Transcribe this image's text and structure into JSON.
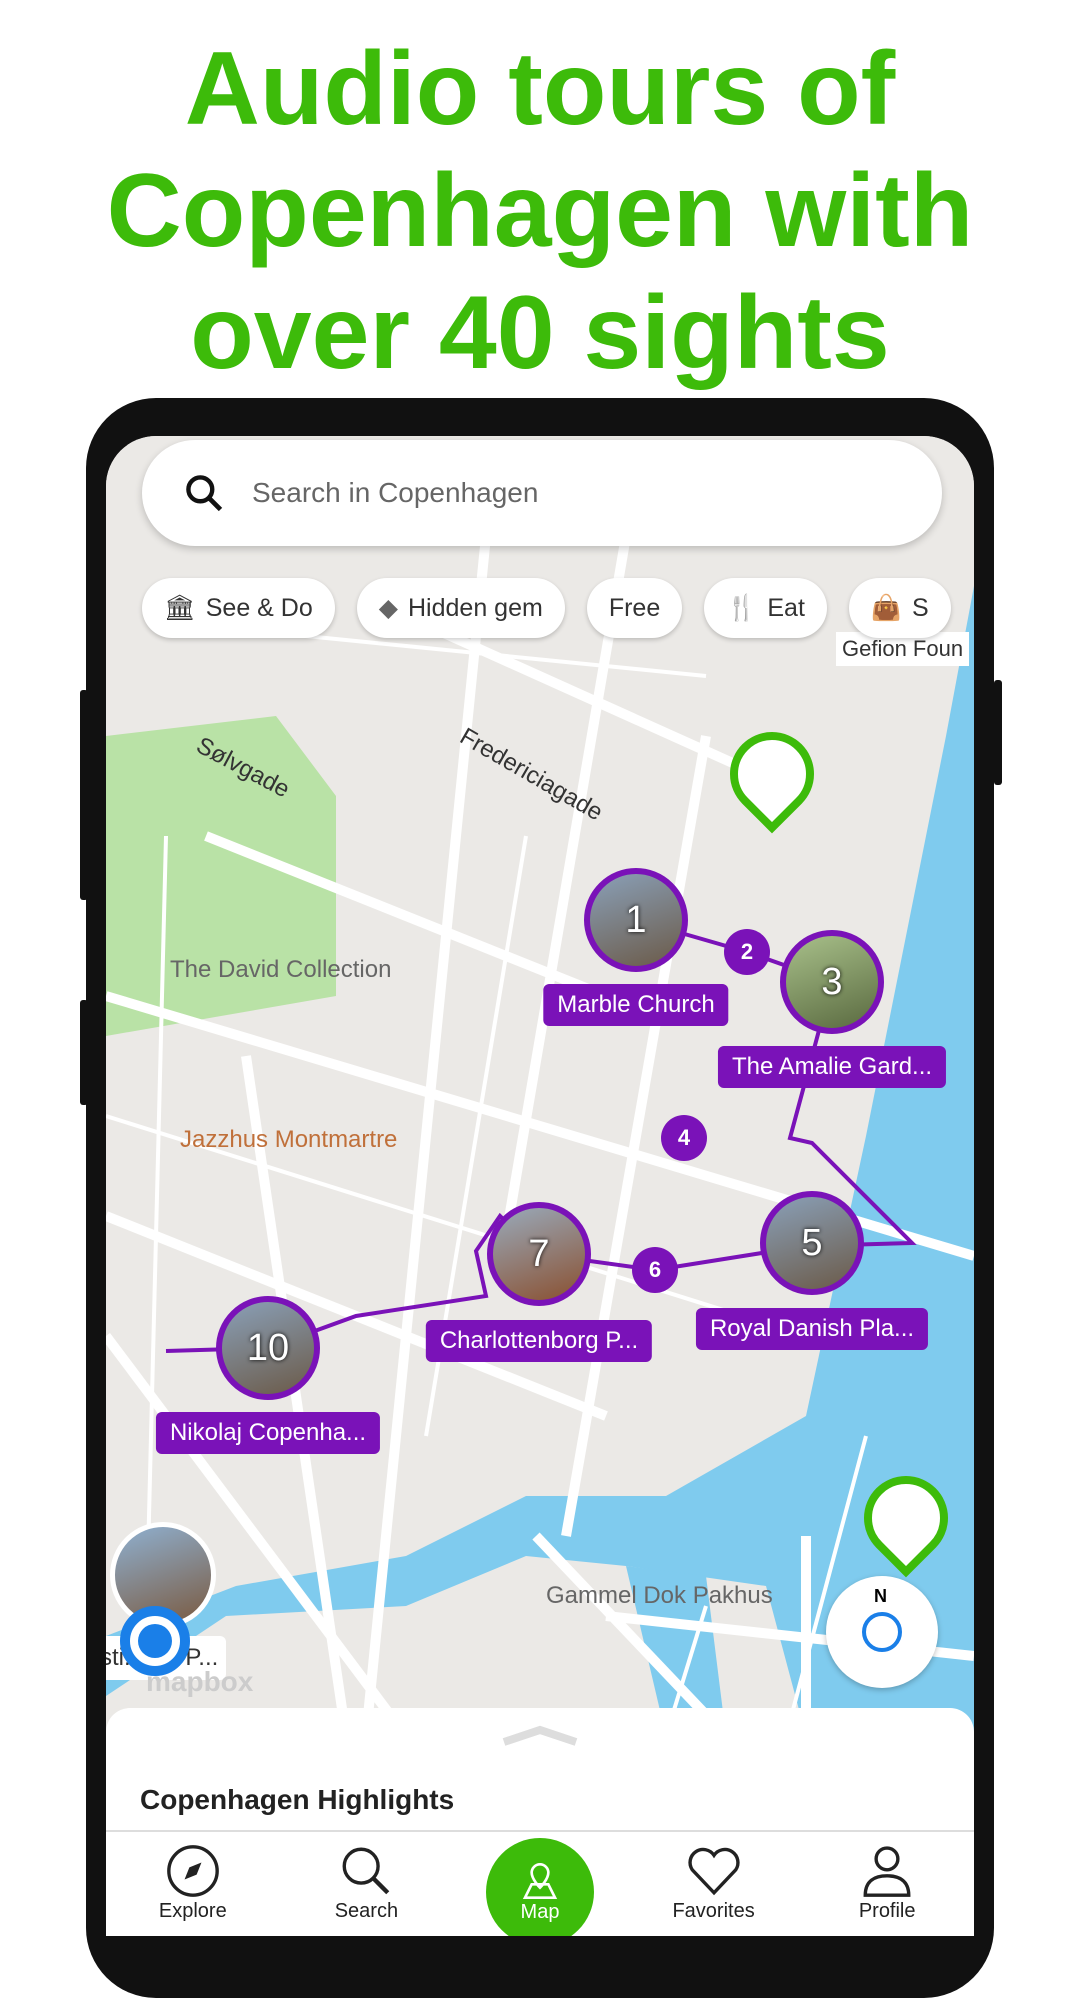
{
  "headline": [
    "Audio tours of",
    "Copenhagen with",
    "over 40 sights"
  ],
  "colors": {
    "brand_green": "#3dbb0a",
    "route_purple": "#7a12b8",
    "water": "#7fcbee",
    "park": "#b9e2a6"
  },
  "search": {
    "placeholder": "Search in Copenhagen",
    "icon": "search-icon"
  },
  "chips": [
    {
      "label": "See & Do",
      "icon": "museum-icon"
    },
    {
      "label": "Hidden gem",
      "icon": "diamond-icon"
    },
    {
      "label": "Free"
    },
    {
      "label": "Eat",
      "icon": "fork-knife-icon"
    },
    {
      "label": "S",
      "icon": "shopping-bag-icon"
    }
  ],
  "map": {
    "streets": [
      "Sølvgade",
      "Fredericiagade"
    ],
    "pois": [
      "The David Collection",
      "Jazzhus Montmartre",
      "Gammel Dok Pakhus",
      "Gefion Foun",
      "sti...org P..."
    ],
    "attribution": "mapbox",
    "stops": [
      {
        "number": "1",
        "label": "Marble Church"
      },
      {
        "number": "2"
      },
      {
        "number": "3",
        "label": "The Amalie Gard..."
      },
      {
        "number": "4"
      },
      {
        "number": "5",
        "label": "Royal Danish Pla..."
      },
      {
        "number": "6"
      },
      {
        "number": "7",
        "label": "Charlottenborg P..."
      },
      {
        "number": "10",
        "label": "Nikolaj Copenha..."
      }
    ],
    "compass_label": "N"
  },
  "sheet": {
    "title": "Copenhagen Highlights"
  },
  "nav": [
    {
      "label": "Explore"
    },
    {
      "label": "Search"
    },
    {
      "label": "Map",
      "active": true
    },
    {
      "label": "Favorites"
    },
    {
      "label": "Profile"
    }
  ]
}
